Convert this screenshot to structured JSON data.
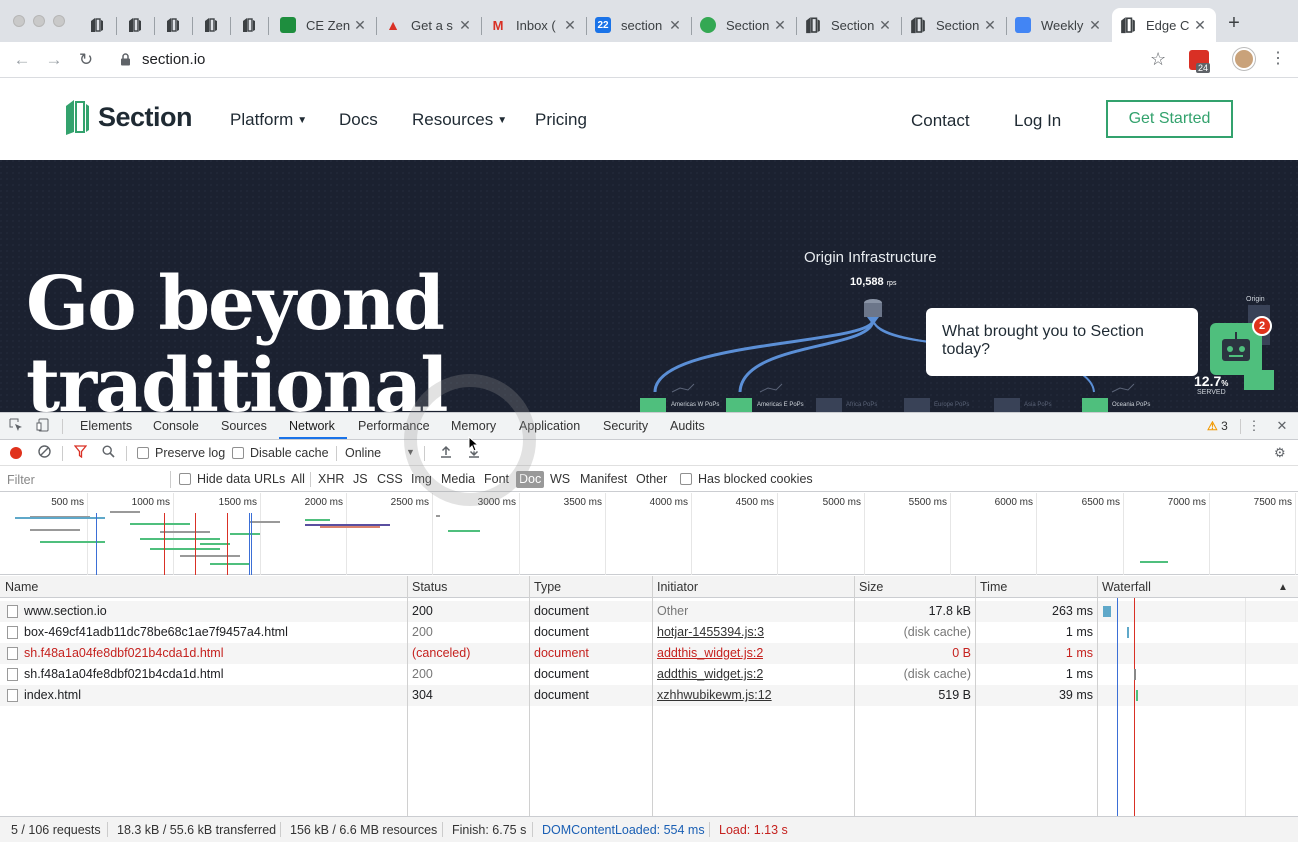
{
  "browser": {
    "tabs": [
      {
        "label": "",
        "icon": "section-logo-icon"
      },
      {
        "label": "",
        "icon": "section-logo-icon"
      },
      {
        "label": "",
        "icon": "section-logo-icon"
      },
      {
        "label": "",
        "icon": "section-logo-icon"
      },
      {
        "label": "",
        "icon": "section-logo-icon"
      },
      {
        "label": "CE Zen",
        "icon": "sheets-icon"
      },
      {
        "label": "Get a s",
        "icon": "warning-triangle-icon"
      },
      {
        "label": "Inbox (",
        "icon": "gmail-icon"
      },
      {
        "label": "section",
        "icon": "calendar-icon"
      },
      {
        "label": "Section",
        "icon": "green-app-icon"
      },
      {
        "label": "Section",
        "icon": "section-logo-icon"
      },
      {
        "label": "Section",
        "icon": "section-logo-icon"
      },
      {
        "label": "Weekly",
        "icon": "docs-icon"
      },
      {
        "label": "Edge C",
        "icon": "section-logo-icon"
      }
    ],
    "active_tab_index": 13,
    "url": "section.io",
    "extension_badge": "24"
  },
  "site": {
    "logo_text": "Section",
    "nav": [
      {
        "label": "Platform",
        "dropdown": true
      },
      {
        "label": "Docs",
        "dropdown": false
      },
      {
        "label": "Resources",
        "dropdown": true
      },
      {
        "label": "Pricing",
        "dropdown": false
      }
    ],
    "contact": "Contact",
    "login": "Log In",
    "cta": "Get Started",
    "brand_color": "#33a26d"
  },
  "hero": {
    "title_line1": "Go beyond",
    "title_line2": "traditional",
    "origin_label": "Origin Infrastructure",
    "origin_rps": "10,588",
    "origin_rps_unit": "rps",
    "origin_small": "Origin",
    "served_value": "12.7",
    "served_unit": "%",
    "served_label": "SERVED",
    "pops": [
      "Americas W PoPs",
      "Americas E PoPs",
      "Africa PoPs",
      "Europe PoPs",
      "Asia PoPs",
      "Oceania PoPs"
    ],
    "chat_text": "What brought you to Section today?",
    "chat_badge": "2"
  },
  "devtools": {
    "tabs": [
      "Elements",
      "Console",
      "Sources",
      "Network",
      "Performance",
      "Memory",
      "Application",
      "Security",
      "Audits"
    ],
    "active_tab": "Network",
    "warning_count": "3",
    "toolbar": {
      "preserve_log": "Preserve log",
      "disable_cache": "Disable cache",
      "throttling": "Online"
    },
    "filter": {
      "placeholder": "Filter",
      "hide_data_urls": "Hide data URLs",
      "types": [
        "All",
        "XHR",
        "JS",
        "CSS",
        "Img",
        "Media",
        "Font",
        "Doc",
        "WS",
        "Manifest",
        "Other"
      ],
      "selected_type": "Doc",
      "has_blocked_cookies": "Has blocked cookies"
    },
    "overview_ticks": [
      "500 ms",
      "1000 ms",
      "1500 ms",
      "2000 ms",
      "2500 ms",
      "3000 ms",
      "3500 ms",
      "4000 ms",
      "4500 ms",
      "5000 ms",
      "5500 ms",
      "6000 ms",
      "6500 ms",
      "7000 ms",
      "7500 ms"
    ],
    "columns": [
      "Name",
      "Status",
      "Type",
      "Initiator",
      "Size",
      "Time",
      "Waterfall"
    ],
    "rows": [
      {
        "name": "www.section.io",
        "status": "200",
        "type": "document",
        "initiator": "Other",
        "initiator_link": false,
        "size": "17.8 kB",
        "time": "263 ms",
        "error": false
      },
      {
        "name": "box-469cf41adb11dc78be68c1ae7f9457a4.html",
        "status": "200",
        "type": "document",
        "initiator": "hotjar-1455394.js:3",
        "initiator_link": true,
        "size": "(disk cache)",
        "time": "1 ms",
        "error": false
      },
      {
        "name": "sh.f48a1a04fe8dbf021b4cda1d.html",
        "status": "(canceled)",
        "type": "document",
        "initiator": "addthis_widget.js:2",
        "initiator_link": true,
        "size": "0 B",
        "time": "1 ms",
        "error": true
      },
      {
        "name": "sh.f48a1a04fe8dbf021b4cda1d.html",
        "status": "200",
        "type": "document",
        "initiator": "addthis_widget.js:2",
        "initiator_link": true,
        "size": "(disk cache)",
        "time": "1 ms",
        "error": false
      },
      {
        "name": "index.html",
        "status": "304",
        "type": "document",
        "initiator": "xzhhwubikewm.js:12",
        "initiator_link": true,
        "size": "519 B",
        "time": "39 ms",
        "error": false
      }
    ],
    "summary": {
      "requests": "5 / 106 requests",
      "transferred": "18.3 kB / 55.6 kB transferred",
      "resources": "156 kB / 6.6 MB resources",
      "finish": "Finish: 6.75 s",
      "dom_content_loaded": "DOMContentLoaded: 554 ms",
      "load": "Load: 1.13 s"
    }
  }
}
